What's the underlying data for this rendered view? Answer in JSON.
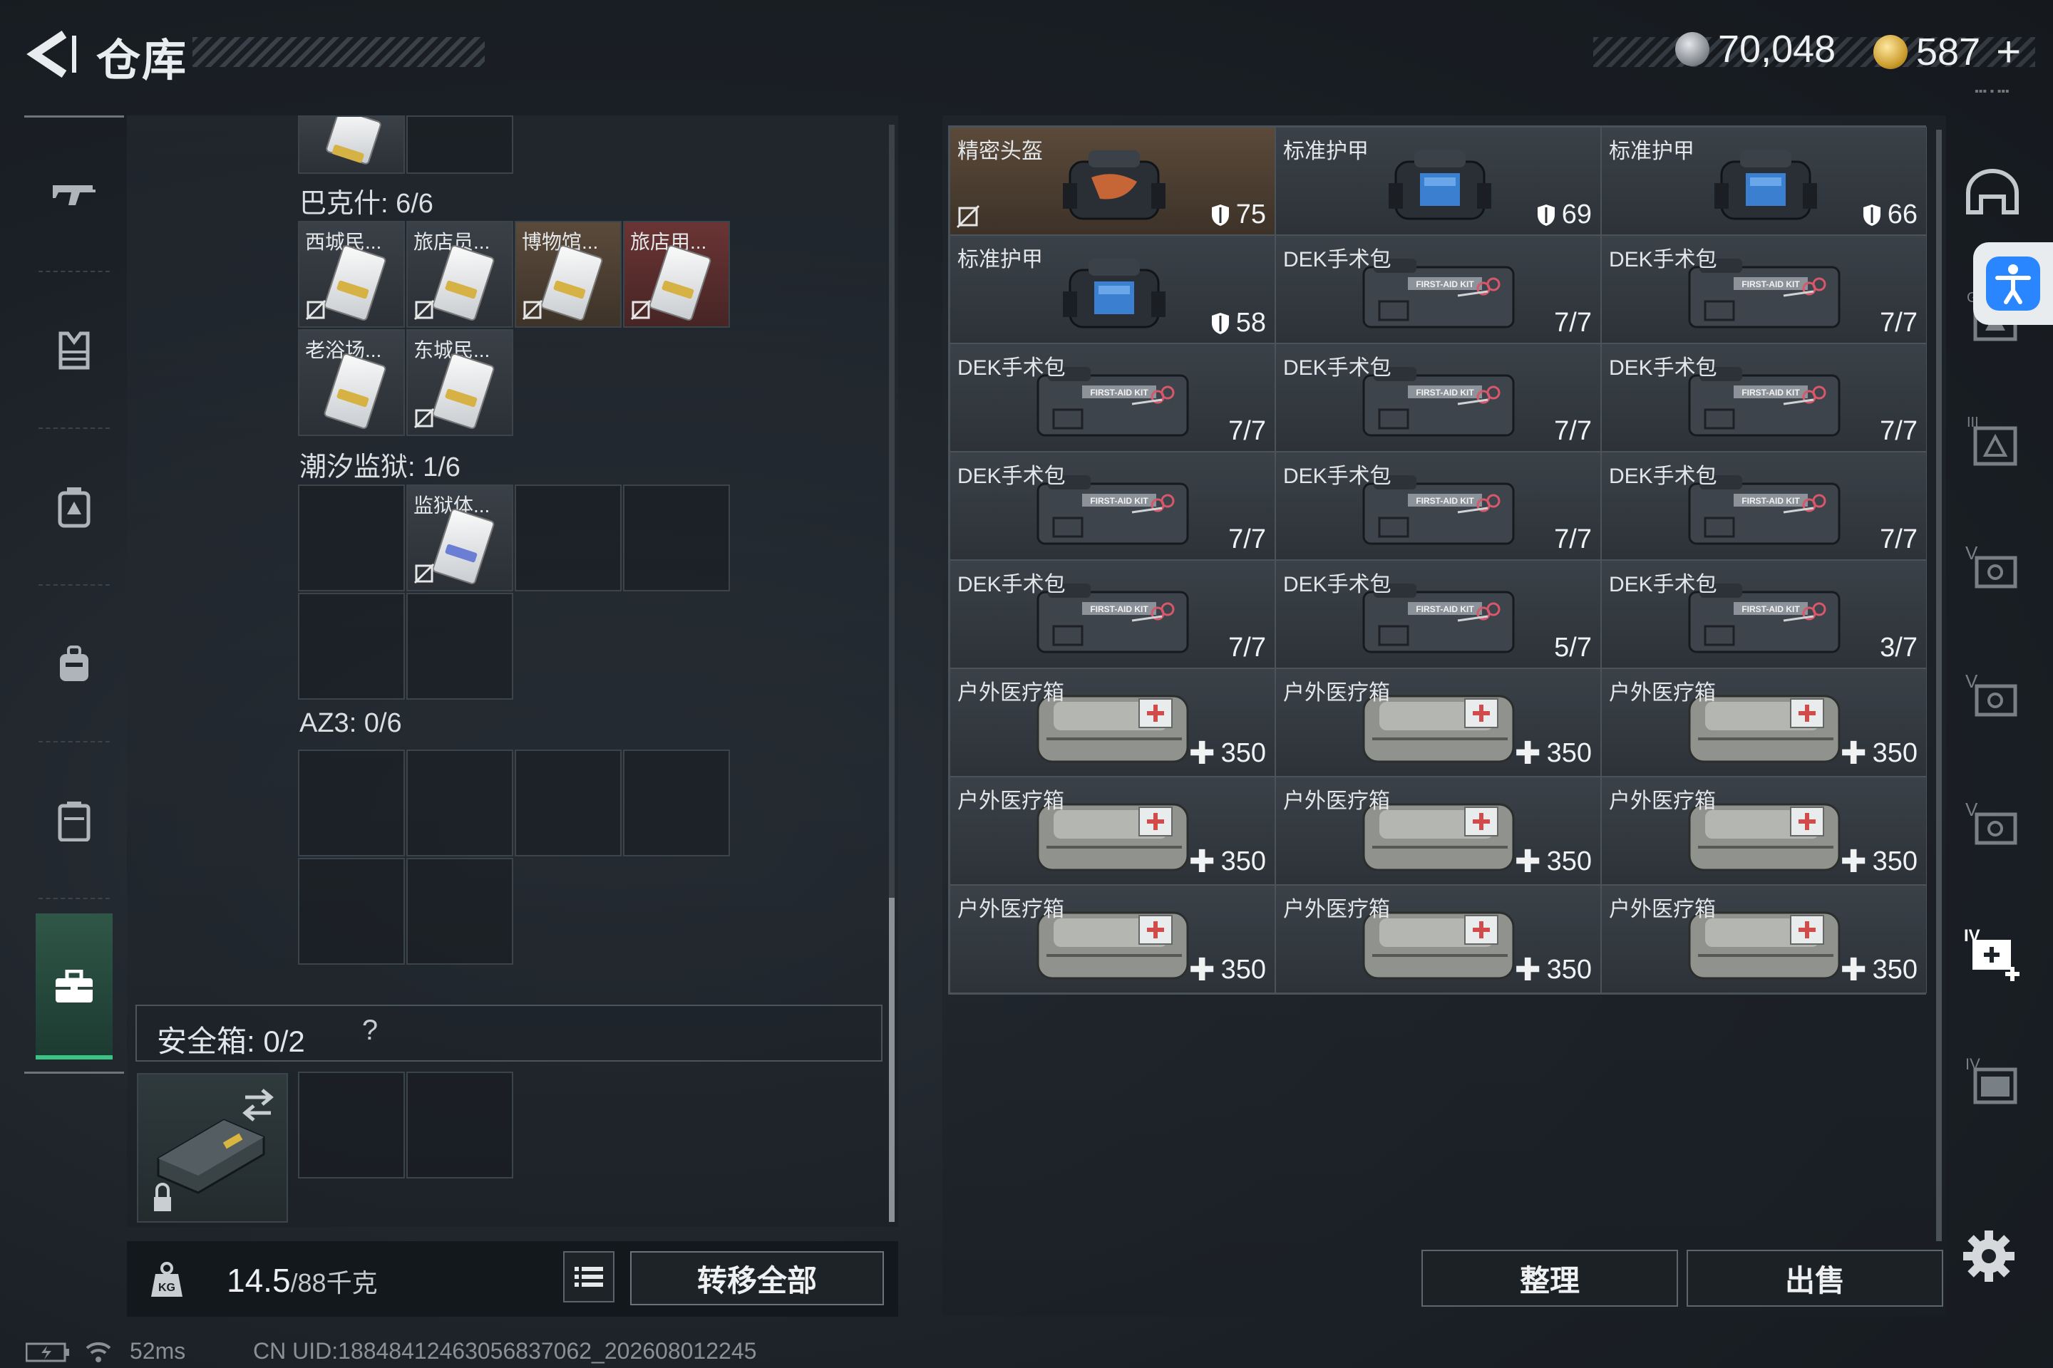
{
  "header": {
    "title": "仓库",
    "silver_amount": "70,048",
    "gold_amount": "587",
    "plus_label": "+"
  },
  "left_nav": {
    "items": [
      {
        "icon": "rifle-icon"
      },
      {
        "icon": "armor-vest-icon"
      },
      {
        "icon": "chest-rig-icon"
      },
      {
        "icon": "backpack-icon"
      },
      {
        "icon": "case-icon"
      },
      {
        "icon": "briefcase-icon",
        "active": true
      }
    ]
  },
  "containers": {
    "bakesh": {
      "label": "巴克什: 6/6",
      "items": [
        "西城民...",
        "旅店员...",
        "博物馆...",
        "旅店用...",
        "老浴场...",
        "东城民..."
      ]
    },
    "prison": {
      "label": "潮汐监狱: 1/6",
      "items": [
        "监狱体..."
      ]
    },
    "az3": {
      "label": "AZ3: 0/6"
    }
  },
  "safebox": {
    "label": "安全箱: 0/2",
    "help": "?"
  },
  "weight": {
    "current": "14.5",
    "max": "/88千克"
  },
  "buttons": {
    "transfer_all": "转移全部",
    "sort": "整理",
    "sell": "出售"
  },
  "stash": {
    "items": [
      {
        "name": "精密头盔",
        "value": "75",
        "kind": "helmet",
        "highlight": true
      },
      {
        "name": "标准护甲",
        "value": "69",
        "kind": "armor"
      },
      {
        "name": "标准护甲",
        "value": "66",
        "kind": "armor"
      },
      {
        "name": "标准护甲",
        "value": "58",
        "kind": "armor"
      },
      {
        "name": "DEK手术包",
        "value": "7/7",
        "kind": "kit"
      },
      {
        "name": "DEK手术包",
        "value": "7/7",
        "kind": "kit"
      },
      {
        "name": "DEK手术包",
        "value": "7/7",
        "kind": "kit"
      },
      {
        "name": "DEK手术包",
        "value": "7/7",
        "kind": "kit"
      },
      {
        "name": "DEK手术包",
        "value": "7/7",
        "kind": "kit"
      },
      {
        "name": "DEK手术包",
        "value": "7/7",
        "kind": "kit"
      },
      {
        "name": "DEK手术包",
        "value": "7/7",
        "kind": "kit"
      },
      {
        "name": "DEK手术包",
        "value": "7/7",
        "kind": "kit"
      },
      {
        "name": "DEK手术包",
        "value": "7/7",
        "kind": "kit"
      },
      {
        "name": "DEK手术包",
        "value": "5/7",
        "kind": "kit"
      },
      {
        "name": "DEK手术包",
        "value": "3/7",
        "kind": "kit"
      },
      {
        "name": "户外医疗箱",
        "value": "350",
        "kind": "medbox"
      },
      {
        "name": "户外医疗箱",
        "value": "350",
        "kind": "medbox"
      },
      {
        "name": "户外医疗箱",
        "value": "350",
        "kind": "medbox"
      },
      {
        "name": "户外医疗箱",
        "value": "350",
        "kind": "medbox"
      },
      {
        "name": "户外医疗箱",
        "value": "350",
        "kind": "medbox"
      },
      {
        "name": "户外医疗箱",
        "value": "350",
        "kind": "medbox"
      },
      {
        "name": "户外医疗箱",
        "value": "350",
        "kind": "medbox"
      },
      {
        "name": "户外医疗箱",
        "value": "350",
        "kind": "medbox"
      },
      {
        "name": "户外医疗箱",
        "value": "350",
        "kind": "medbox"
      }
    ]
  },
  "right_nav": {
    "items": [
      "helmet-tab-icon",
      "armor-tier-6-icon",
      "armor-tier-3-icon",
      "armor-tier-5-icon",
      "armor-tier-5b-icon",
      "armor-tier-5c-icon",
      "armor-tier-4-add-icon",
      "armor-tier-4-icon"
    ]
  },
  "status": {
    "ping": "52ms",
    "uid": "CN UID:18848412463056837062_202608012245"
  },
  "colors": {
    "accent_green": "#39c484",
    "accessibility_blue": "#2a86ff"
  }
}
